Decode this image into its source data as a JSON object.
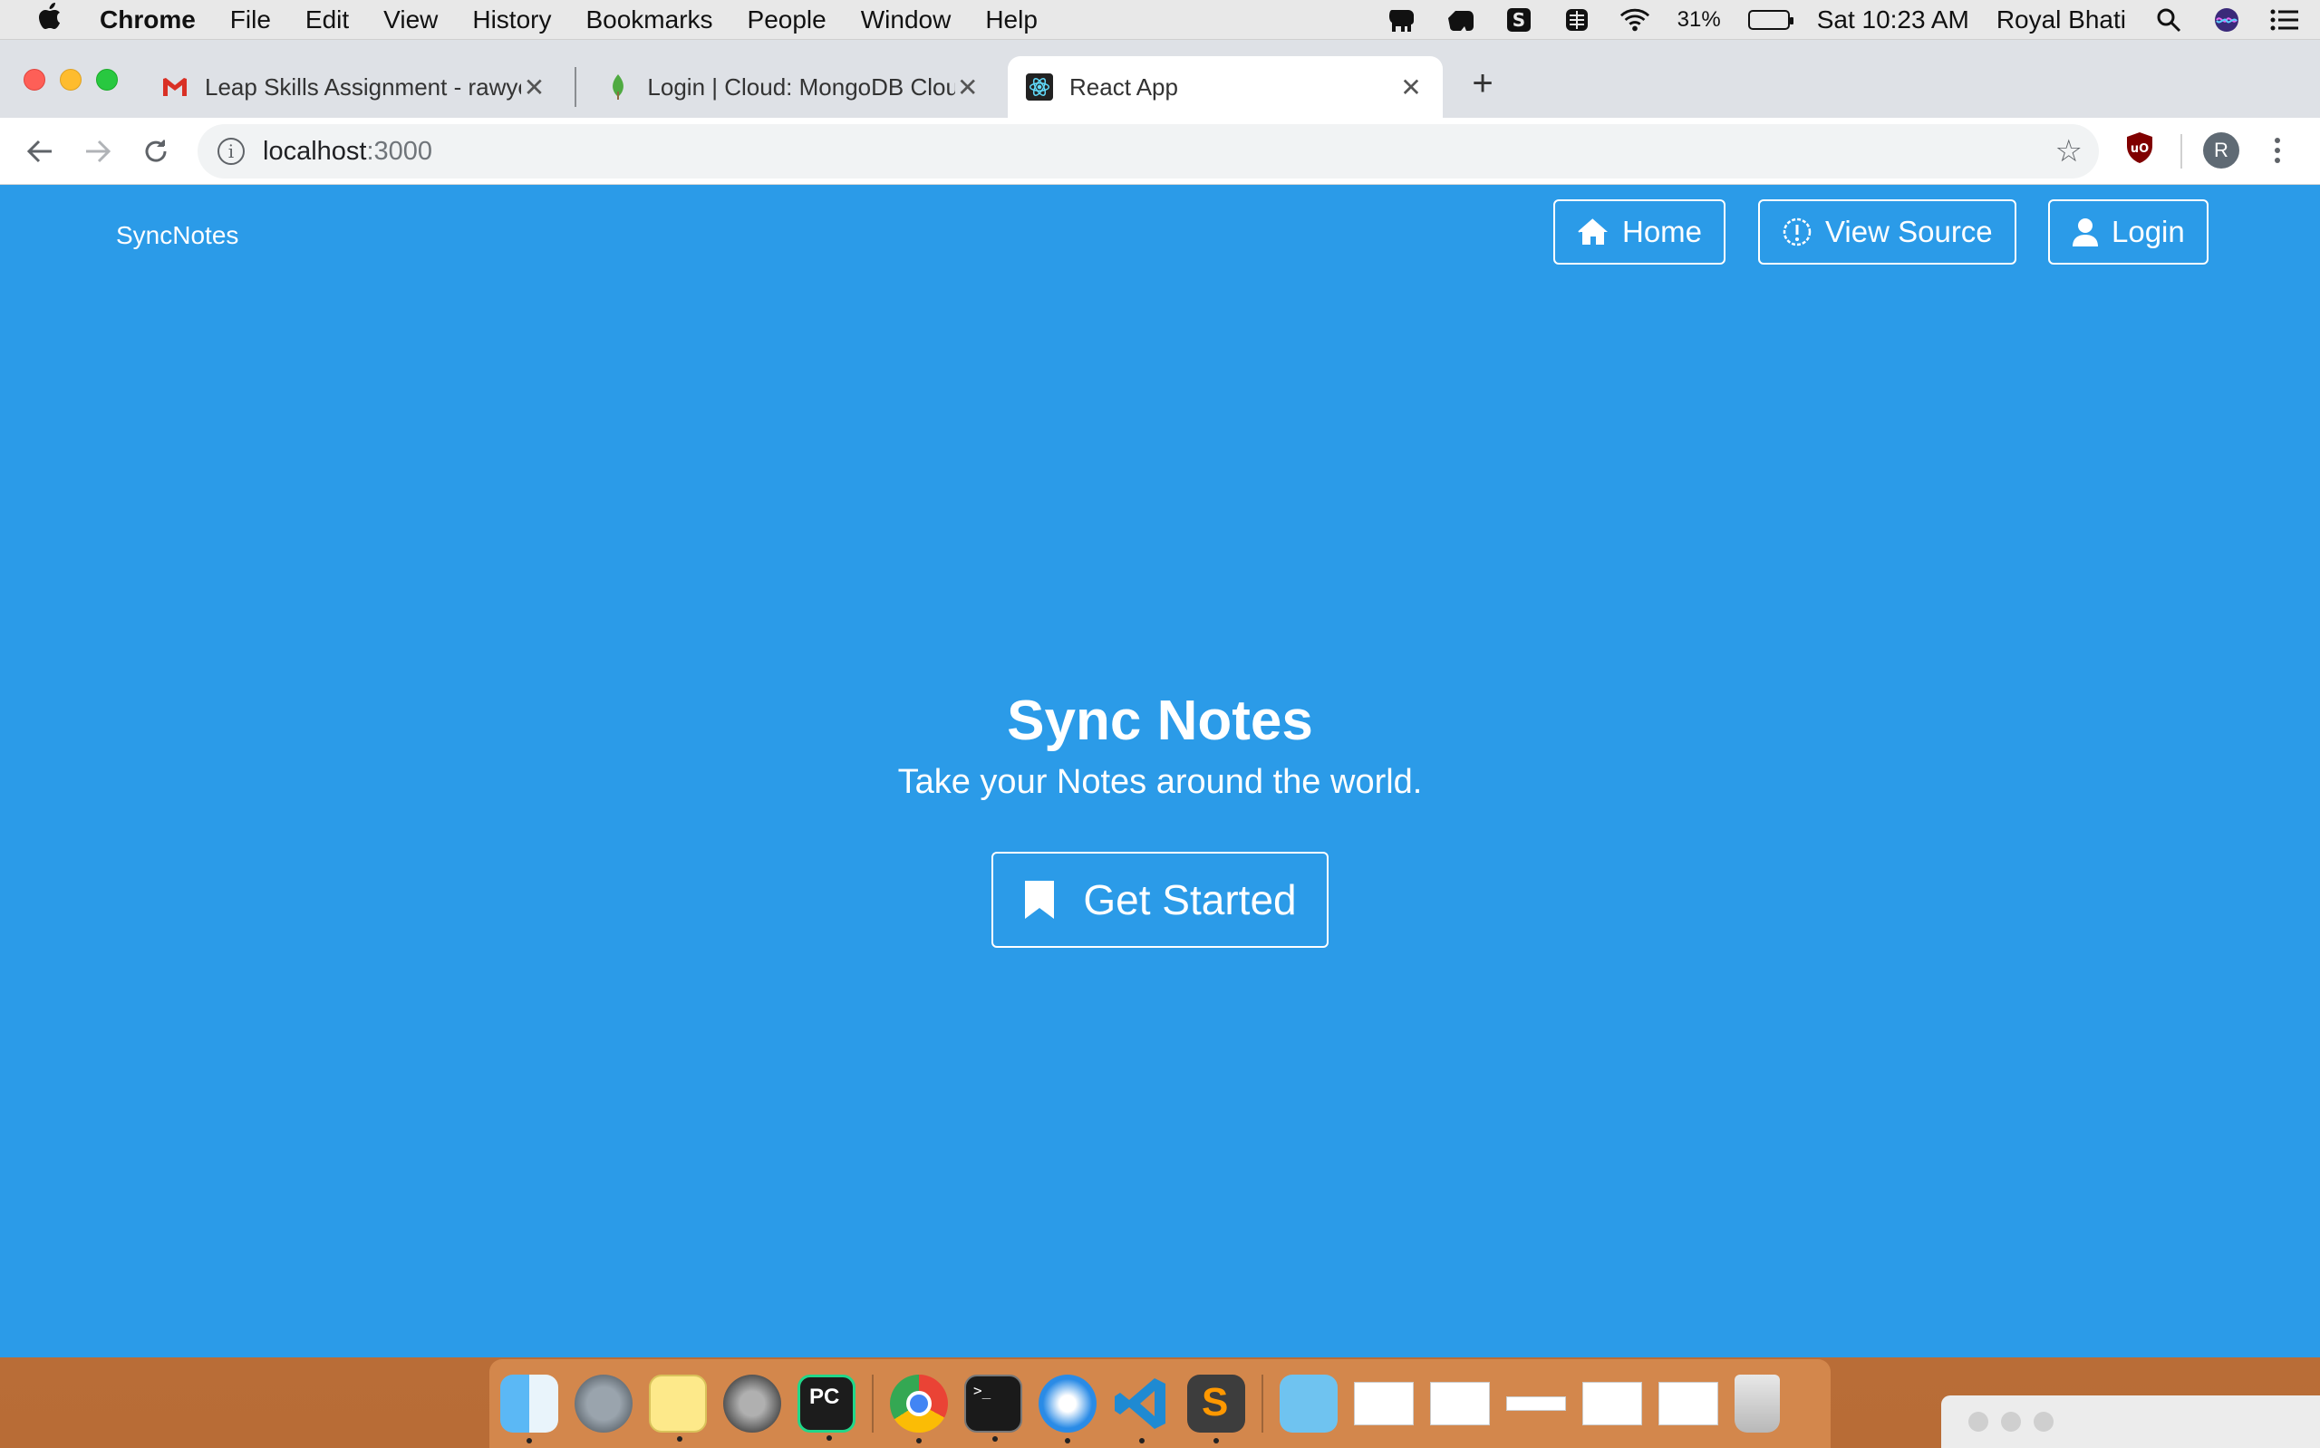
{
  "menubar": {
    "app": "Chrome",
    "items": [
      "File",
      "Edit",
      "View",
      "History",
      "Bookmarks",
      "People",
      "Window",
      "Help"
    ],
    "battery_pct": "31%",
    "battery_level": 0.31,
    "clock": "Sat 10:23 AM",
    "user": "Royal Bhati"
  },
  "tabs": [
    {
      "title": "Leap Skills Assignment - rawye",
      "icon": "gmail-icon",
      "close": "✕"
    },
    {
      "title": "Login | Cloud: MongoDB Cloud",
      "icon": "mongodb-leaf-icon",
      "close": "✕"
    },
    {
      "title": "React App",
      "icon": "react-icon",
      "close": "✕"
    }
  ],
  "newtab": "+",
  "omnibox": {
    "host": "localhost",
    "port": ":3000",
    "info": "i",
    "star": "☆"
  },
  "profile_initial": "R",
  "page": {
    "brand": "SyncNotes",
    "nav": [
      {
        "label": "Home",
        "icon": "home-icon"
      },
      {
        "label": "View Source",
        "icon": "exclamation-circle-icon"
      },
      {
        "label": "Login",
        "icon": "user-icon"
      }
    ],
    "hero_title": "Sync Notes",
    "hero_subtitle": "Take your Notes around the world.",
    "cta_label": "Get Started",
    "cta_icon": "bookmark-icon",
    "bg_color": "#2b9be8"
  }
}
